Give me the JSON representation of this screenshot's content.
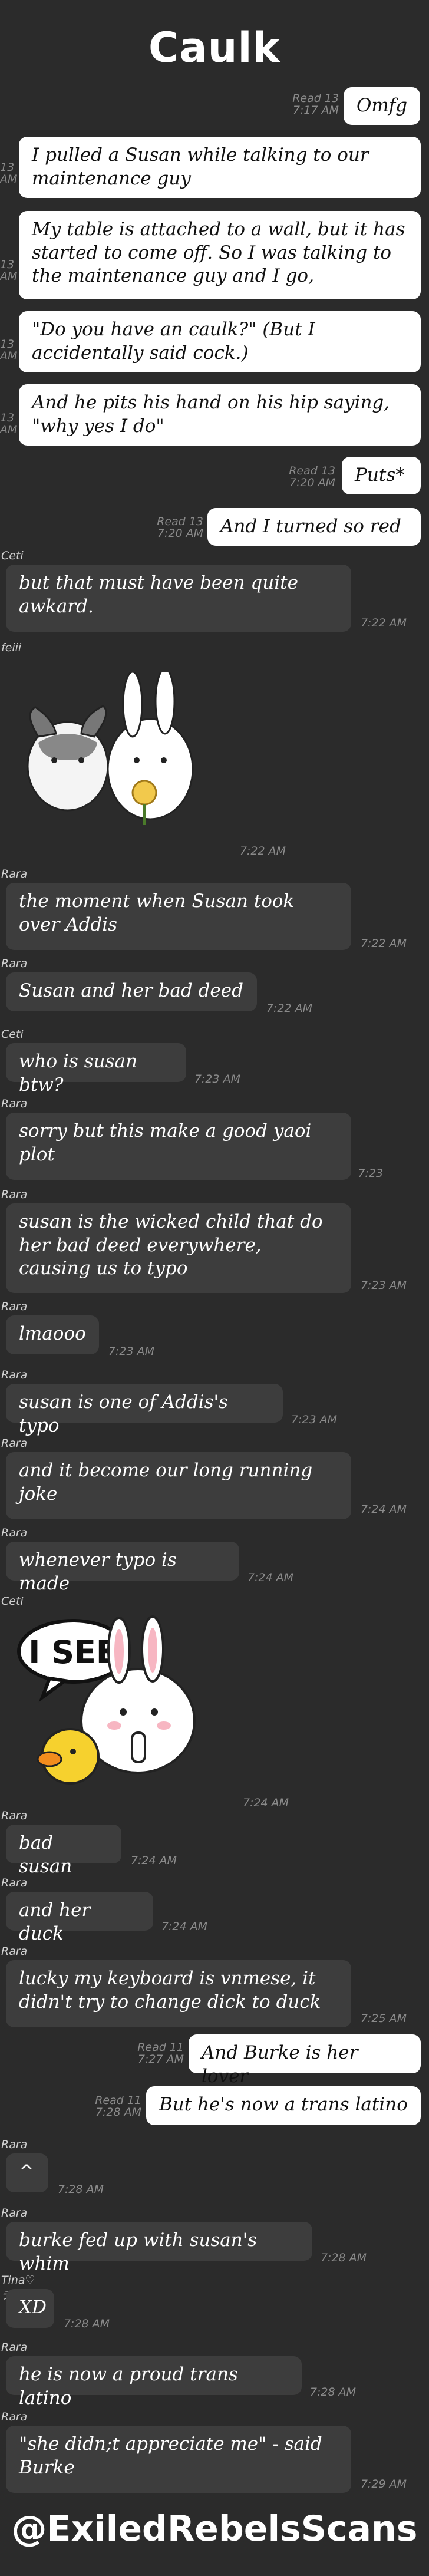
{
  "header": {
    "title": "Caulk"
  },
  "messages": [
    {
      "side": "me",
      "text": "Omfg",
      "read": "Read 13",
      "time": "7:17 AM"
    },
    {
      "side": "me",
      "text": "I pulled a Susan while talking to our maintenance guy",
      "read": "13",
      "time": "AM"
    },
    {
      "side": "me",
      "text": "My table is attached to a wall, but it has started to come off. So I was talking to the maintenance guy and I go,",
      "read": "13",
      "time": "AM"
    },
    {
      "side": "me",
      "text": "\"Do you have an caulk?\" (But I accidentally said cock.)",
      "read": "13",
      "time": "AM"
    },
    {
      "side": "me",
      "text": "And he pits his hand on his hip saying, \"why yes I do\"",
      "read": "13",
      "time": "AM"
    },
    {
      "side": "me",
      "text": "Puts*",
      "read": "Read 13",
      "time": "7:20 AM"
    },
    {
      "side": "me",
      "text": "And I turned so red",
      "read": "Read 13",
      "time": "7:20 AM"
    },
    {
      "side": "other",
      "sender": "Ceti",
      "text": "but that must have been quite awkard.",
      "time": "7:22 AM"
    },
    {
      "side": "other",
      "sender": "feiii",
      "sticker": "bunnies-sticker",
      "time": "7:22 AM"
    },
    {
      "side": "other",
      "sender": "Rara",
      "text": "the moment when Susan took over Addis",
      "time": "7:22 AM"
    },
    {
      "side": "other",
      "sender": "Rara",
      "text": "Susan and her bad deed",
      "time": "7:22 AM"
    },
    {
      "side": "other",
      "sender": "Ceti",
      "text": "who is susan btw?",
      "time": "7:23 AM"
    },
    {
      "side": "other",
      "sender": "Rara",
      "text": "sorry but this make a good yaoi plot",
      "time": "7:23"
    },
    {
      "side": "other",
      "sender": "Rara",
      "text": "susan is the wicked child that do her bad deed everywhere, causing us to typo",
      "time": "7:23 AM"
    },
    {
      "side": "other",
      "sender": "Rara",
      "text": "lmaooo",
      "time": "7:23 AM"
    },
    {
      "side": "other",
      "sender": "Rara",
      "text": "susan is one of Addis's typo",
      "time": "7:23 AM"
    },
    {
      "side": "other",
      "sender": "Rara",
      "text": "and it become our long running joke",
      "time": "7:24 AM"
    },
    {
      "side": "other",
      "sender": "Rara",
      "text": "whenever typo is made",
      "time": "7:24 AM"
    },
    {
      "side": "other",
      "sender": "Ceti",
      "sticker": "i-see-sticker",
      "sticker_text": "I SEE",
      "time": "7:24 AM"
    },
    {
      "side": "other",
      "sender": "Rara",
      "text": "bad susan",
      "time": "7:24 AM"
    },
    {
      "side": "other",
      "sender": "Rara",
      "text": "and her duck",
      "time": "7:24 AM"
    },
    {
      "side": "other",
      "sender": "Rara",
      "text": "lucky my keyboard is vnmese, it didn't try to change dick to duck",
      "time": "7:25 AM"
    },
    {
      "side": "me",
      "text": "And Burke is her lover",
      "read": "Read 11",
      "time": "7:27 AM"
    },
    {
      "side": "me",
      "text": "But he's now a trans latino",
      "read": "Read 11",
      "time": "7:28 AM"
    },
    {
      "side": "other",
      "sender": "Rara",
      "text": "^",
      "time": "7:28 AM"
    },
    {
      "side": "other",
      "sender": "Rara",
      "text": "burke fed up with susan's whim",
      "time": "7:28 AM"
    },
    {
      "side": "other",
      "sender": "Tina♡ティナ",
      "text": "XD",
      "time": "7:28 AM"
    },
    {
      "side": "other",
      "sender": "Rara",
      "text": "he is now a proud trans latino",
      "time": "7:28 AM"
    },
    {
      "side": "other",
      "sender": "Rara",
      "text": "\"she didn;t appreciate me\" - said Burke",
      "time": "7:29 AM"
    }
  ],
  "footer": {
    "watermark": "@ExiledRebelsScans"
  }
}
